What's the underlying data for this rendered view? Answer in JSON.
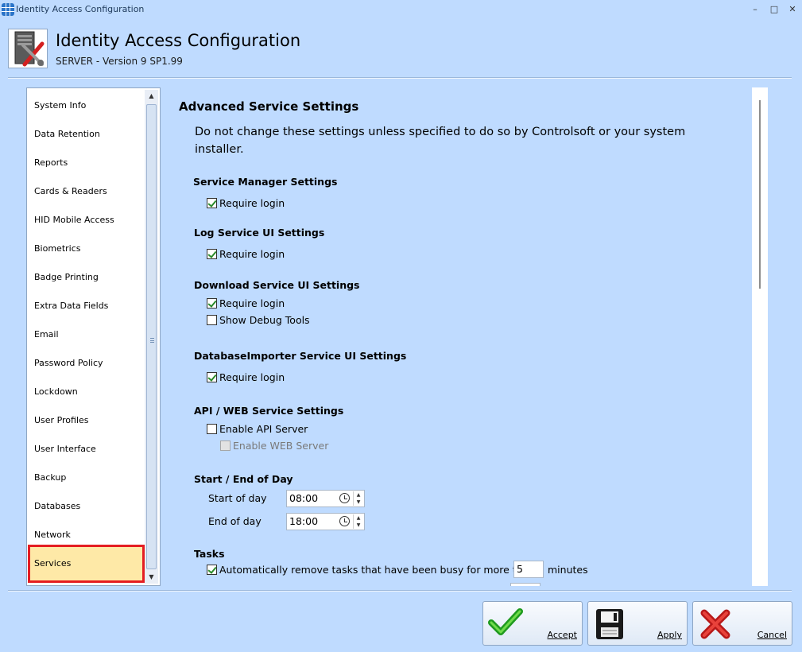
{
  "window": {
    "title": "Identity Access Configuration",
    "minimize_glyph": "–",
    "maximize_glyph": "□",
    "close_glyph": "✕"
  },
  "header": {
    "title": "Identity Access Configuration",
    "subtitle": "SERVER - Version 9 SP1.99"
  },
  "nav": {
    "items": [
      {
        "label": "System Info"
      },
      {
        "label": "Data Retention"
      },
      {
        "label": "Reports"
      },
      {
        "label": "Cards & Readers"
      },
      {
        "label": "HID Mobile Access"
      },
      {
        "label": "Biometrics"
      },
      {
        "label": "Badge Printing"
      },
      {
        "label": "Extra Data Fields"
      },
      {
        "label": "Email"
      },
      {
        "label": "Password Policy"
      },
      {
        "label": "Lockdown"
      },
      {
        "label": "User Profiles"
      },
      {
        "label": "User Interface"
      },
      {
        "label": "Backup"
      },
      {
        "label": "Databases"
      },
      {
        "label": "Network"
      },
      {
        "label": "Services"
      }
    ],
    "selected": "Services"
  },
  "content": {
    "title": "Advanced Service Settings",
    "description": "Do not change these settings unless specified to do so by Controlsoft or your system installer.",
    "service_manager": {
      "heading": "Service Manager Settings",
      "require_login": "Require login",
      "require_login_checked": true
    },
    "log_service": {
      "heading": "Log Service UI Settings",
      "require_login": "Require login",
      "require_login_checked": true
    },
    "download_service": {
      "heading": "Download Service UI Settings",
      "require_login": "Require login",
      "require_login_checked": true,
      "debug_tools": "Show Debug Tools",
      "debug_tools_checked": false
    },
    "db_importer": {
      "heading": "DatabaseImporter Service UI Settings",
      "require_login": "Require login",
      "require_login_checked": true
    },
    "api_web": {
      "heading": "API / WEB Service Settings",
      "enable_api": "Enable API Server",
      "enable_api_checked": false,
      "enable_web": "Enable WEB Server",
      "enable_web_checked": false
    },
    "day": {
      "heading": "Start / End of Day",
      "start_label": "Start of day",
      "start_value": "08:00",
      "end_label": "End of day",
      "end_value": "18:00"
    },
    "tasks": {
      "heading": "Tasks",
      "auto_remove_label": "Automatically remove tasks that have been busy for more than",
      "auto_remove_checked": true,
      "minutes_value": "5",
      "minutes_unit": "minutes"
    }
  },
  "buttons": {
    "accept": "Accept",
    "apply": "Apply",
    "cancel": "Cancel"
  }
}
